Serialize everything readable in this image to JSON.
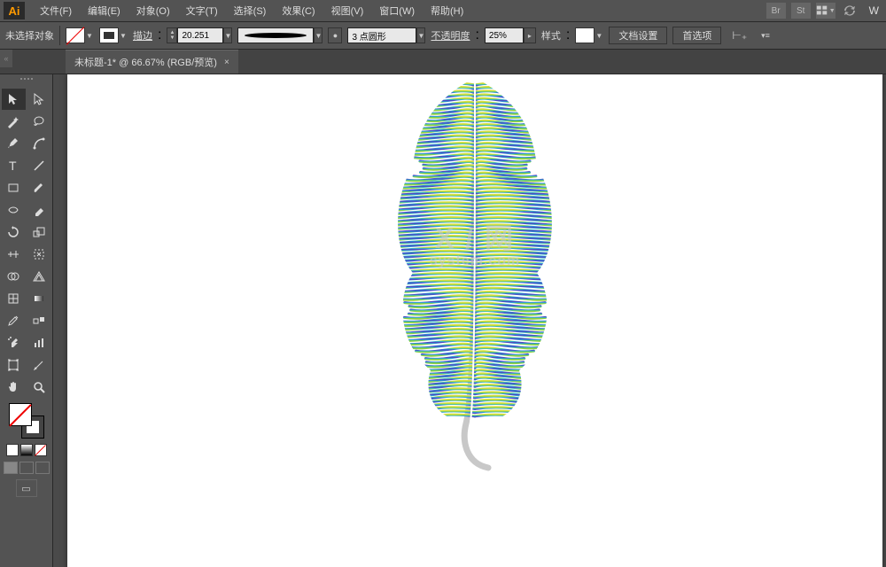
{
  "app": {
    "icon_text": "Ai"
  },
  "menu": {
    "items": [
      "文件(F)",
      "编辑(E)",
      "对象(O)",
      "文字(T)",
      "选择(S)",
      "效果(C)",
      "视图(V)",
      "窗口(W)",
      "帮助(H)"
    ],
    "right_icons": [
      "Br",
      "St"
    ]
  },
  "control": {
    "no_selection": "未选择对象",
    "stroke_label": "描边",
    "stroke_value": "20.251",
    "profile_label": "3 点圆形",
    "opacity_label": "不透明度",
    "opacity_value": "25%",
    "style_label": "样式",
    "doc_setup": "文档设置",
    "prefs": "首选项"
  },
  "tab": {
    "title": "未标题-1* @ 66.67% (RGB/预览)",
    "close": "×"
  },
  "dock_handle": "«",
  "tools": {
    "rows": [
      [
        "selection",
        "direct-selection"
      ],
      [
        "magic-wand",
        "lasso"
      ],
      [
        "pen",
        "curvature"
      ],
      [
        "type",
        "line"
      ],
      [
        "rectangle",
        "paintbrush"
      ],
      [
        "shaper",
        "eraser"
      ],
      [
        "rotate",
        "scale"
      ],
      [
        "width",
        "free-transform"
      ],
      [
        "shape-builder",
        "perspective"
      ],
      [
        "mesh",
        "gradient"
      ],
      [
        "eyedropper",
        "blend"
      ],
      [
        "symbol-sprayer",
        "graph"
      ],
      [
        "artboard",
        "slice"
      ],
      [
        "hand",
        "zoom"
      ]
    ]
  },
  "watermark": {
    "main": "X / 网",
    "sub": "system.com"
  },
  "top_right_letter": "W"
}
